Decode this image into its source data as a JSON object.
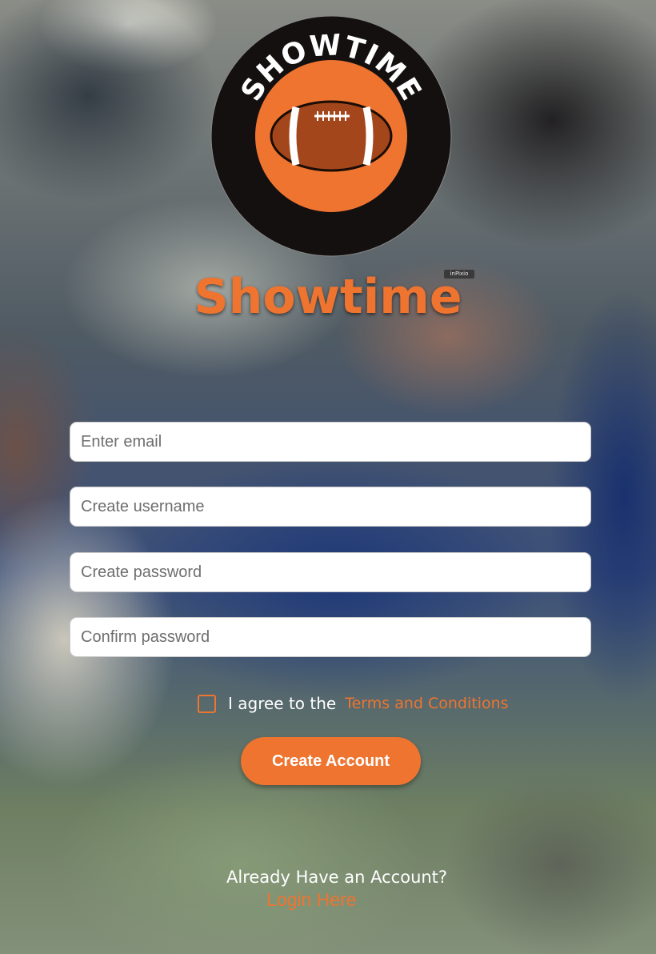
{
  "brand": {
    "logo_text": "SHOWTIME",
    "title": "Showtime",
    "watermark": "inPixio"
  },
  "form": {
    "email_placeholder": "Enter email",
    "username_placeholder": "Create username",
    "password_placeholder": "Create password",
    "confirm_placeholder": "Confirm password"
  },
  "terms": {
    "text": "I agree to the",
    "link": "Terms and Conditions",
    "checked": false
  },
  "actions": {
    "create_label": "Create Account"
  },
  "footer": {
    "prompt": "Already Have an Account?",
    "login_label": "Login Here"
  },
  "colors": {
    "accent": "#ee7430",
    "logo_ring": "#141010",
    "football": "#a3461b"
  },
  "icons": {
    "logo": "football-icon"
  }
}
